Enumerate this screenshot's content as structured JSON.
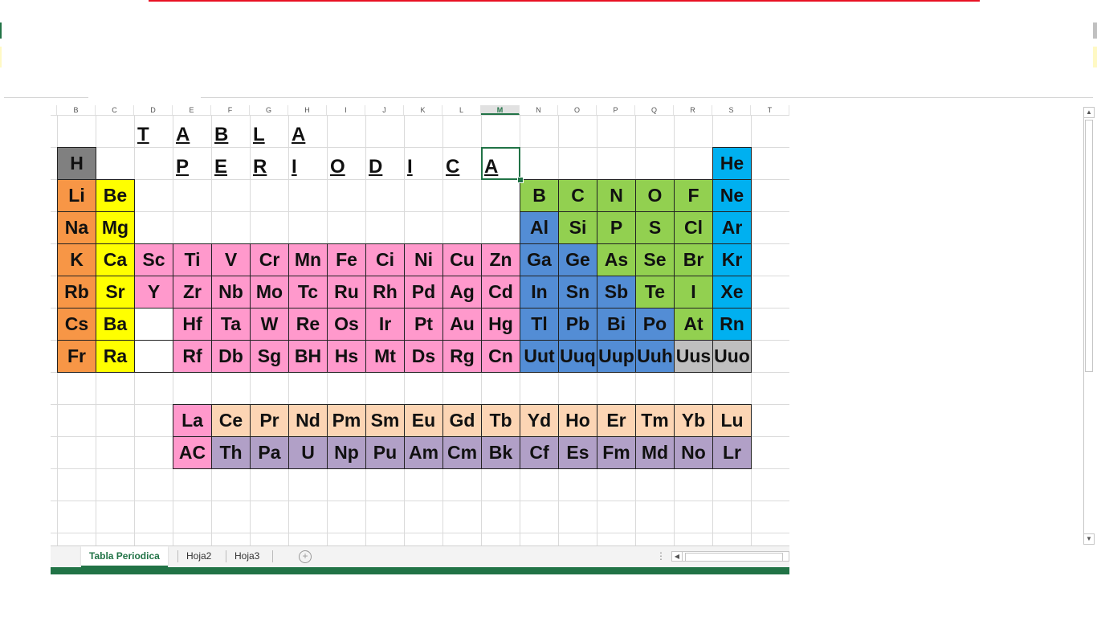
{
  "columns": [
    "B",
    "C",
    "D",
    "E",
    "F",
    "G",
    "H",
    "I",
    "J",
    "K",
    "L",
    "M",
    "N",
    "O",
    "P",
    "Q",
    "R",
    "S",
    "T"
  ],
  "selected_column": "M",
  "title_word1": [
    "T",
    "A",
    "B",
    "L",
    "A"
  ],
  "title_word2": [
    "P",
    "E",
    "R",
    "I",
    "O",
    "D",
    "I",
    "C",
    "A"
  ],
  "colors": {
    "gray": "#808080",
    "orange": "#f79646",
    "yellow": "#ffff00",
    "pink": "#ff99cc",
    "green": "#92d050",
    "blue": "#538dd5",
    "cyan": "#00b0f0",
    "lightgray": "#bfbfbf",
    "peach": "#fcd5b4",
    "purple": "#b1a0c7",
    "white": "#ffffff"
  },
  "main_rows": [
    [
      [
        "H",
        "gray"
      ],
      null,
      null,
      null,
      null,
      null,
      null,
      null,
      null,
      null,
      null,
      null,
      null,
      null,
      null,
      null,
      null,
      [
        "He",
        "cyan"
      ]
    ],
    [
      [
        "Li",
        "orange"
      ],
      [
        "Be",
        "yellow"
      ],
      null,
      null,
      null,
      null,
      null,
      null,
      null,
      null,
      null,
      null,
      [
        "B",
        "green"
      ],
      [
        "C",
        "green"
      ],
      [
        "N",
        "green"
      ],
      [
        "O",
        "green"
      ],
      [
        "F",
        "green"
      ],
      [
        "Ne",
        "cyan"
      ]
    ],
    [
      [
        "Na",
        "orange"
      ],
      [
        "Mg",
        "yellow"
      ],
      null,
      null,
      null,
      null,
      null,
      null,
      null,
      null,
      null,
      null,
      [
        "Al",
        "blue"
      ],
      [
        "Si",
        "green"
      ],
      [
        "P",
        "green"
      ],
      [
        "S",
        "green"
      ],
      [
        "Cl",
        "green"
      ],
      [
        "Ar",
        "cyan"
      ]
    ],
    [
      [
        "K",
        "orange"
      ],
      [
        "Ca",
        "yellow"
      ],
      [
        "Sc",
        "pink"
      ],
      [
        "Ti",
        "pink"
      ],
      [
        "V",
        "pink"
      ],
      [
        "Cr",
        "pink"
      ],
      [
        "Mn",
        "pink"
      ],
      [
        "Fe",
        "pink"
      ],
      [
        "Ci",
        "pink"
      ],
      [
        "Ni",
        "pink"
      ],
      [
        "Cu",
        "pink"
      ],
      [
        "Zn",
        "pink"
      ],
      [
        "Ga",
        "blue"
      ],
      [
        "Ge",
        "blue"
      ],
      [
        "As",
        "green"
      ],
      [
        "Se",
        "green"
      ],
      [
        "Br",
        "green"
      ],
      [
        "Kr",
        "cyan"
      ]
    ],
    [
      [
        "Rb",
        "orange"
      ],
      [
        "Sr",
        "yellow"
      ],
      [
        "Y",
        "pink"
      ],
      [
        "Zr",
        "pink"
      ],
      [
        "Nb",
        "pink"
      ],
      [
        "Mo",
        "pink"
      ],
      [
        "Tc",
        "pink"
      ],
      [
        "Ru",
        "pink"
      ],
      [
        "Rh",
        "pink"
      ],
      [
        "Pd",
        "pink"
      ],
      [
        "Ag",
        "pink"
      ],
      [
        "Cd",
        "pink"
      ],
      [
        "In",
        "blue"
      ],
      [
        "Sn",
        "blue"
      ],
      [
        "Sb",
        "blue"
      ],
      [
        "Te",
        "green"
      ],
      [
        "I",
        "green"
      ],
      [
        "Xe",
        "cyan"
      ]
    ],
    [
      [
        "Cs",
        "orange"
      ],
      [
        "Ba",
        "yellow"
      ],
      [
        "",
        "white"
      ],
      [
        "Hf",
        "pink"
      ],
      [
        "Ta",
        "pink"
      ],
      [
        "W",
        "pink"
      ],
      [
        "Re",
        "pink"
      ],
      [
        "Os",
        "pink"
      ],
      [
        "Ir",
        "pink"
      ],
      [
        "Pt",
        "pink"
      ],
      [
        "Au",
        "pink"
      ],
      [
        "Hg",
        "pink"
      ],
      [
        "Tl",
        "blue"
      ],
      [
        "Pb",
        "blue"
      ],
      [
        "Bi",
        "blue"
      ],
      [
        "Po",
        "blue"
      ],
      [
        "At",
        "green"
      ],
      [
        "Rn",
        "cyan"
      ]
    ],
    [
      [
        "Fr",
        "orange"
      ],
      [
        "Ra",
        "yellow"
      ],
      [
        "",
        "white"
      ],
      [
        "Rf",
        "pink"
      ],
      [
        "Db",
        "pink"
      ],
      [
        "Sg",
        "pink"
      ],
      [
        "BH",
        "pink"
      ],
      [
        "Hs",
        "pink"
      ],
      [
        "Mt",
        "pink"
      ],
      [
        "Ds",
        "pink"
      ],
      [
        "Rg",
        "pink"
      ],
      [
        "Cn",
        "pink"
      ],
      [
        "Uut",
        "blue"
      ],
      [
        "Uuq",
        "blue"
      ],
      [
        "Uup",
        "blue"
      ],
      [
        "Uuh",
        "blue"
      ],
      [
        "Uus",
        "lightgray"
      ],
      [
        "Uuo",
        "lightgray"
      ]
    ]
  ],
  "lanthanides": [
    [
      "La",
      "pink"
    ],
    [
      "Ce",
      "peach"
    ],
    [
      "Pr",
      "peach"
    ],
    [
      "Nd",
      "peach"
    ],
    [
      "Pm",
      "peach"
    ],
    [
      "Sm",
      "peach"
    ],
    [
      "Eu",
      "peach"
    ],
    [
      "Gd",
      "peach"
    ],
    [
      "Tb",
      "peach"
    ],
    [
      "Yd",
      "peach"
    ],
    [
      "Ho",
      "peach"
    ],
    [
      "Er",
      "peach"
    ],
    [
      "Tm",
      "peach"
    ],
    [
      "Yb",
      "peach"
    ],
    [
      "Lu",
      "peach"
    ]
  ],
  "actinides": [
    [
      "AC",
      "pink"
    ],
    [
      "Th",
      "purple"
    ],
    [
      "Pa",
      "purple"
    ],
    [
      "U",
      "purple"
    ],
    [
      "Np",
      "purple"
    ],
    [
      "Pu",
      "purple"
    ],
    [
      "Am",
      "purple"
    ],
    [
      "Cm",
      "purple"
    ],
    [
      "Bk",
      "purple"
    ],
    [
      "Cf",
      "purple"
    ],
    [
      "Es",
      "purple"
    ],
    [
      "Fm",
      "purple"
    ],
    [
      "Md",
      "purple"
    ],
    [
      "No",
      "purple"
    ],
    [
      "Lr",
      "purple"
    ]
  ],
  "sheet_tabs": {
    "tab1": "Tabla Periodica",
    "tab2": "Hoja2",
    "tab3": "Hoja3",
    "add_icon": "plus-circle-icon"
  }
}
